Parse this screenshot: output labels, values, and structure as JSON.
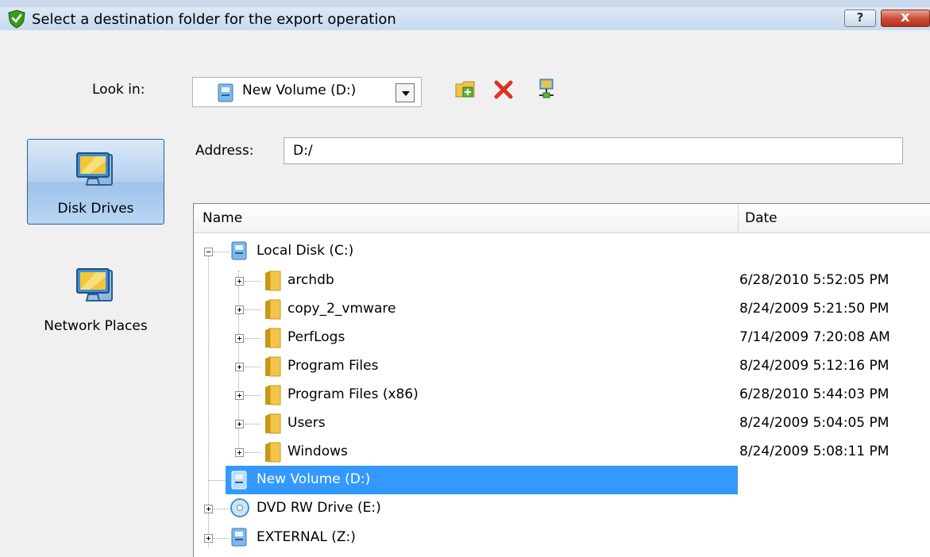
{
  "window": {
    "title": "Select a destination folder for the export operation",
    "help_label": "?",
    "close_label": "x"
  },
  "toolbar": {
    "lookin_label": "Look in:",
    "lookin_value": "New Volume (D:)",
    "icons": [
      "new-folder-icon",
      "delete-icon",
      "network-icon"
    ]
  },
  "nav": {
    "disk_drives": "Disk Drives",
    "network_places": "Network Places"
  },
  "address": {
    "label": "Address:",
    "value": "D:/"
  },
  "tree": {
    "columns": {
      "name": "Name",
      "date": "Date"
    },
    "rows": [
      {
        "label": "Local Disk (C:)",
        "date": ""
      },
      {
        "label": "archdb",
        "date": "6/28/2010 5:52:05 PM"
      },
      {
        "label": "copy_2_vmware",
        "date": "8/24/2009 5:21:50 PM"
      },
      {
        "label": "PerfLogs",
        "date": "7/14/2009 7:20:08 AM"
      },
      {
        "label": "Program Files",
        "date": "8/24/2009 5:12:16 PM"
      },
      {
        "label": "Program Files (x86)",
        "date": "6/28/2010 5:44:03 PM"
      },
      {
        "label": "Users",
        "date": "8/24/2009 5:04:05 PM"
      },
      {
        "label": "Windows",
        "date": "8/24/2009 5:08:11 PM"
      },
      {
        "label": "New Volume (D:)",
        "date": ""
      },
      {
        "label": "DVD RW Drive (E:)",
        "date": ""
      },
      {
        "label": "EXTERNAL (Z:)",
        "date": ""
      }
    ]
  },
  "colors": {
    "selection": "#3399ff",
    "title_bar": "#c6d9ef",
    "accent_green": "#3a9a1e"
  }
}
